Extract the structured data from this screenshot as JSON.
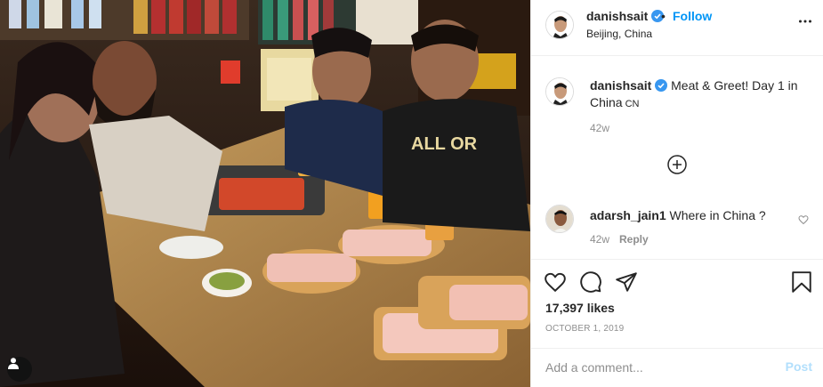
{
  "header": {
    "username": "danishsait",
    "follow_separator": "•",
    "follow_label": "Follow",
    "location": "Beijing, China"
  },
  "caption": {
    "username": "danishsait",
    "text": "Meat & Greet! Day 1 in China",
    "country_code": "CN",
    "time": "42w"
  },
  "comments": [
    {
      "username": "adarsh_jain1",
      "text": "Where in China ?",
      "time": "42w",
      "reply_label": "Reply"
    }
  ],
  "actions": {
    "likes": "17,397 likes",
    "date": "OCTOBER 1, 2019"
  },
  "composer": {
    "placeholder": "Add a comment...",
    "post_label": "Post"
  },
  "colors": {
    "link_blue": "#0095f6",
    "post_disabled": "#b2dffc",
    "muted": "#8e8e8e",
    "verified": "#3897f0"
  },
  "icons": [
    "verified-badge-icon",
    "more-options-icon",
    "load-more-comments-icon",
    "heart-icon",
    "comment-icon",
    "share-icon",
    "bookmark-icon",
    "user-tag-icon"
  ]
}
